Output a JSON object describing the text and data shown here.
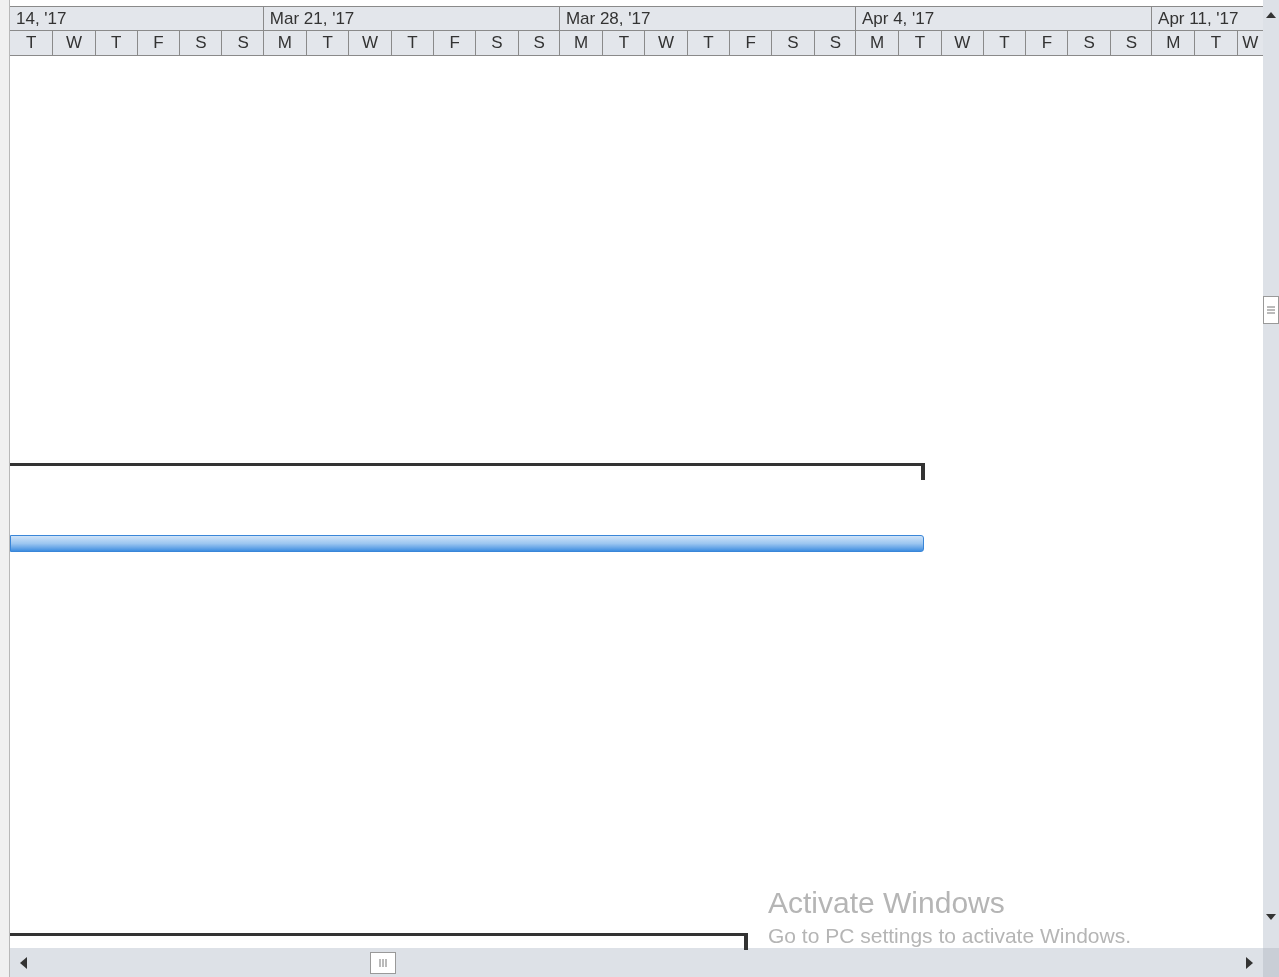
{
  "timescale": {
    "weeks": [
      {
        "label": "14, '17",
        "days": [
          "T",
          "W",
          "T",
          "F",
          "S",
          "S"
        ]
      },
      {
        "label": "Mar 21, '17",
        "days": [
          "M",
          "T",
          "W",
          "T",
          "F",
          "S",
          "S"
        ]
      },
      {
        "label": "Mar 28, '17",
        "days": [
          "M",
          "T",
          "W",
          "T",
          "F",
          "S",
          "S"
        ]
      },
      {
        "label": "Apr 4, '17",
        "days": [
          "M",
          "T",
          "W",
          "T",
          "F",
          "S",
          "S"
        ]
      },
      {
        "label": "Apr 11, '17",
        "days": [
          "M",
          "T",
          "W"
        ]
      }
    ]
  },
  "bars": [
    {
      "kind": "summary"
    },
    {
      "kind": "task"
    },
    {
      "kind": "summary"
    }
  ],
  "os_notice": {
    "title": "Activate Windows",
    "message": "Go to PC settings to activate Windows."
  }
}
